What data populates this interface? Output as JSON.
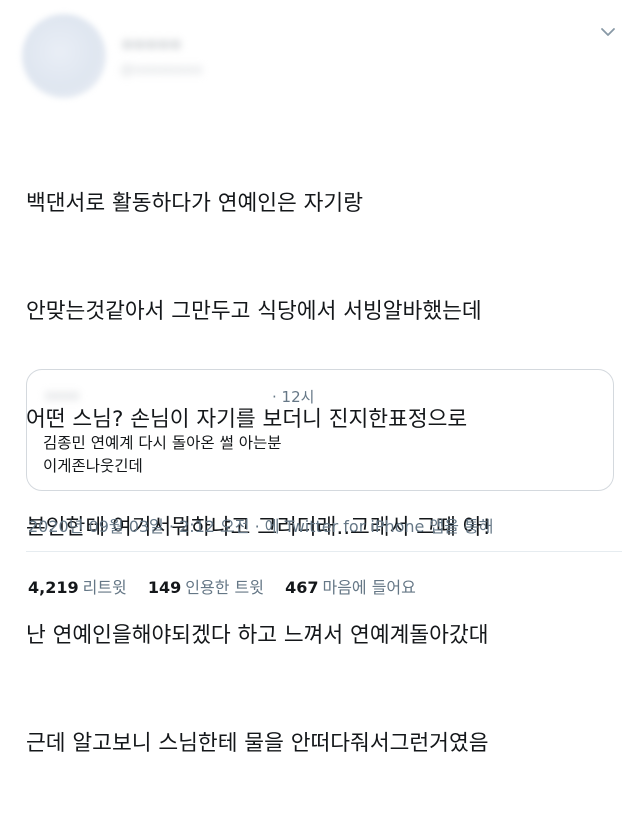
{
  "tweet": {
    "author": {
      "display_name": "ooooo",
      "handle": "@oooooooo"
    },
    "body_lines": [
      "백댄서로 활동하다가 연예인은 자기랑",
      "안맞는것같아서 그만두고 식당에서 서빙알바했는데",
      "어떤 스님? 손님이 자기를 보더니 진지한표정으로",
      "본인한테 여기서뭐하냐고 그러더래..그래서 그때 아!",
      "난 연예인을해야되겠다 하고 느껴서 연예계돌아갔대",
      "근데 알고보니 스님한테 물을 안떠다줘서그런거였음"
    ],
    "quoted": {
      "name": "oooo",
      "time": "· 12시",
      "lines": [
        "김종민 연예계 다시 돌아온 썰 아는분",
        "이게존나웃긴데"
      ]
    },
    "meta": {
      "date": "2020년 09월 03일 · 2:12 오전 ·",
      "via_prefix": "에",
      "client": "Twitter for iPhone",
      "via_suffix": "앱을 통해"
    },
    "stats": {
      "retweets": {
        "count": "4,219",
        "label": "리트윗"
      },
      "quotes": {
        "count": "149",
        "label": "인용한 트윗"
      },
      "likes": {
        "count": "467",
        "label": "마음에 들어요"
      }
    }
  },
  "icons": {
    "menu": "chevron-down-icon"
  },
  "colors": {
    "text": "#14171a",
    "secondary": "#657786",
    "border": "#d4d9de"
  }
}
